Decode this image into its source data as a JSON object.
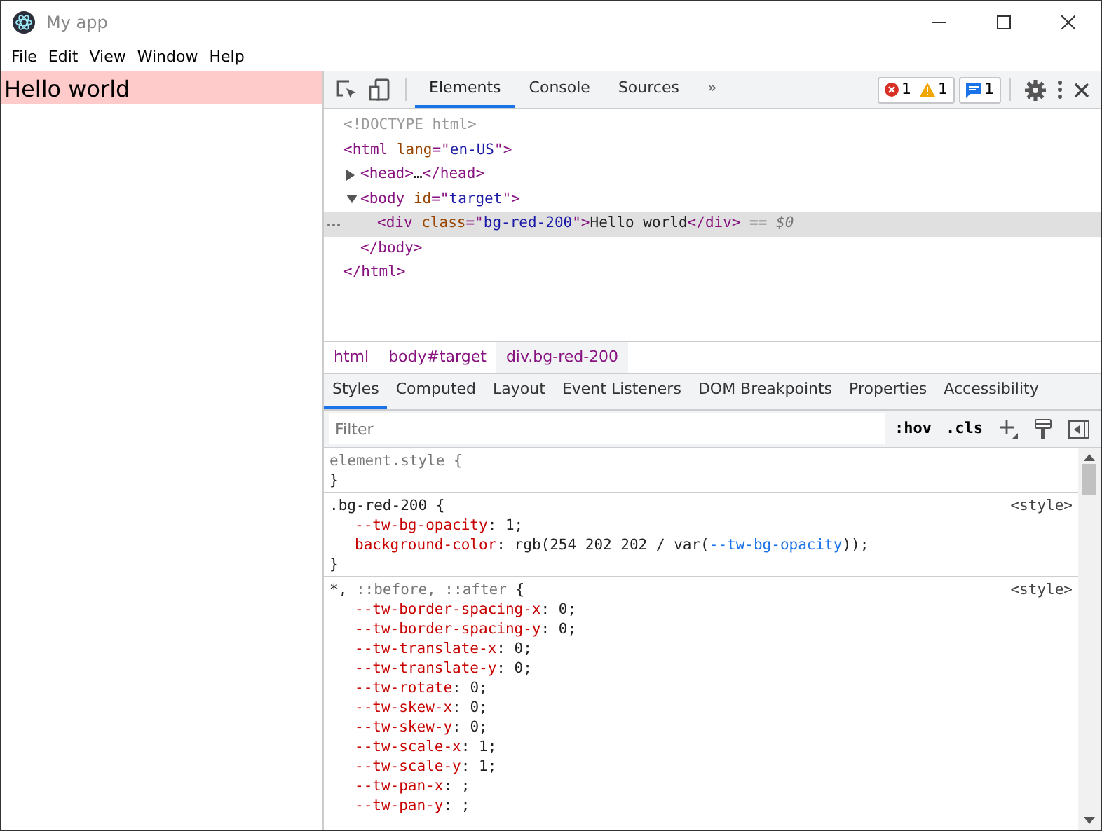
{
  "window": {
    "title": "My app"
  },
  "menu": [
    "File",
    "Edit",
    "View",
    "Window",
    "Help"
  ],
  "app_content": {
    "text": "Hello world"
  },
  "devtools": {
    "tabs": [
      {
        "label": "Elements",
        "selected": true
      },
      {
        "label": "Console",
        "selected": false
      },
      {
        "label": "Sources",
        "selected": false
      }
    ],
    "more_tabs": "»",
    "issues": {
      "errors": "1",
      "warnings": "1",
      "messages": "1"
    },
    "dom_tree": [
      {
        "selected": false,
        "segments": [
          {
            "kind": "comment",
            "text": "<!DOCTYPE html>"
          }
        ]
      },
      {
        "selected": false,
        "segments": [
          {
            "kind": "tag",
            "text": "<html "
          },
          {
            "kind": "attr",
            "text": "lang"
          },
          {
            "kind": "tag",
            "text": "=\""
          },
          {
            "kind": "value",
            "text": "en-US"
          },
          {
            "kind": "tag",
            "text": "\">"
          }
        ],
        "children": [
          {
            "selected": false,
            "expanded": false,
            "segments": [
              {
                "kind": "tag",
                "text": "<head>"
              },
              {
                "kind": "plain",
                "text": "…"
              },
              {
                "kind": "tag",
                "text": "</head>"
              }
            ]
          },
          {
            "selected": false,
            "expanded": true,
            "segments": [
              {
                "kind": "tag",
                "text": "<body "
              },
              {
                "kind": "attr",
                "text": "id"
              },
              {
                "kind": "tag",
                "text": "=\""
              },
              {
                "kind": "value",
                "text": "target"
              },
              {
                "kind": "tag",
                "text": "\">"
              }
            ],
            "children": [
              {
                "selected": true,
                "segments": [
                  {
                    "kind": "tag",
                    "text": "<div "
                  },
                  {
                    "kind": "attr",
                    "text": "class"
                  },
                  {
                    "kind": "tag",
                    "text": "=\""
                  },
                  {
                    "kind": "value",
                    "text": "bg-red-200"
                  },
                  {
                    "kind": "tag",
                    "text": "\">"
                  },
                  {
                    "kind": "plain",
                    "text": "Hello world"
                  },
                  {
                    "kind": "tag",
                    "text": "</div>"
                  },
                  {
                    "kind": "hint",
                    "text": " == $0"
                  }
                ]
              }
            ],
            "closing": [
              {
                "kind": "tag",
                "text": "</body>"
              }
            ]
          }
        ],
        "closing": [
          {
            "kind": "tag",
            "text": "</html>"
          }
        ]
      }
    ],
    "breadcrumbs": [
      {
        "label": "html",
        "selected": false
      },
      {
        "label": "body#target",
        "selected": false
      },
      {
        "label": "div.bg-red-200",
        "selected": true
      }
    ],
    "sidebar_tabs": [
      {
        "label": "Styles",
        "selected": true
      },
      {
        "label": "Computed",
        "selected": false
      },
      {
        "label": "Layout",
        "selected": false
      },
      {
        "label": "Event Listeners",
        "selected": false
      },
      {
        "label": "DOM Breakpoints",
        "selected": false
      },
      {
        "label": "Properties",
        "selected": false
      },
      {
        "label": "Accessibility",
        "selected": false
      }
    ],
    "filter": {
      "placeholder": "Filter"
    },
    "toolbar_buttons": [
      ":hov",
      ".cls"
    ],
    "rules": [
      {
        "selector": [
          {
            "kind": "inline",
            "text": "element.style {"
          }
        ],
        "close": "}"
      },
      {
        "source": "<style>",
        "selector": [
          {
            "kind": "plain",
            "text": ".bg-red-200 {"
          }
        ],
        "declarations": [
          [
            {
              "kind": "prop",
              "text": "--tw-bg-opacity"
            },
            {
              "kind": "plain",
              "text": ": 1;"
            }
          ],
          [
            {
              "kind": "prop",
              "text": "background-color"
            },
            {
              "kind": "plain",
              "text": ": rgb(254 202 202 / var("
            },
            {
              "kind": "var",
              "text": "--tw-bg-opacity"
            },
            {
              "kind": "plain",
              "text": "));"
            }
          ]
        ],
        "close": "}"
      },
      {
        "source": "<style>",
        "selector": [
          {
            "kind": "plain",
            "text": "*, "
          },
          {
            "kind": "inline",
            "text": "::before, ::after"
          },
          {
            "kind": "plain",
            "text": " {"
          }
        ],
        "declarations": [
          [
            {
              "kind": "prop",
              "text": "--tw-border-spacing-x"
            },
            {
              "kind": "plain",
              "text": ": 0;"
            }
          ],
          [
            {
              "kind": "prop",
              "text": "--tw-border-spacing-y"
            },
            {
              "kind": "plain",
              "text": ": 0;"
            }
          ],
          [
            {
              "kind": "prop",
              "text": "--tw-translate-x"
            },
            {
              "kind": "plain",
              "text": ": 0;"
            }
          ],
          [
            {
              "kind": "prop",
              "text": "--tw-translate-y"
            },
            {
              "kind": "plain",
              "text": ": 0;"
            }
          ],
          [
            {
              "kind": "prop",
              "text": "--tw-rotate"
            },
            {
              "kind": "plain",
              "text": ": 0;"
            }
          ],
          [
            {
              "kind": "prop",
              "text": "--tw-skew-x"
            },
            {
              "kind": "plain",
              "text": ": 0;"
            }
          ],
          [
            {
              "kind": "prop",
              "text": "--tw-skew-y"
            },
            {
              "kind": "plain",
              "text": ": 0;"
            }
          ],
          [
            {
              "kind": "prop",
              "text": "--tw-scale-x"
            },
            {
              "kind": "plain",
              "text": ": 1;"
            }
          ],
          [
            {
              "kind": "prop",
              "text": "--tw-scale-y"
            },
            {
              "kind": "plain",
              "text": ": 1;"
            }
          ],
          [
            {
              "kind": "prop",
              "text": "--tw-pan-x"
            },
            {
              "kind": "plain",
              "text": ": ;"
            }
          ],
          [
            {
              "kind": "prop",
              "text": "--tw-pan-y"
            },
            {
              "kind": "plain",
              "text": ": ;"
            }
          ]
        ]
      }
    ]
  }
}
